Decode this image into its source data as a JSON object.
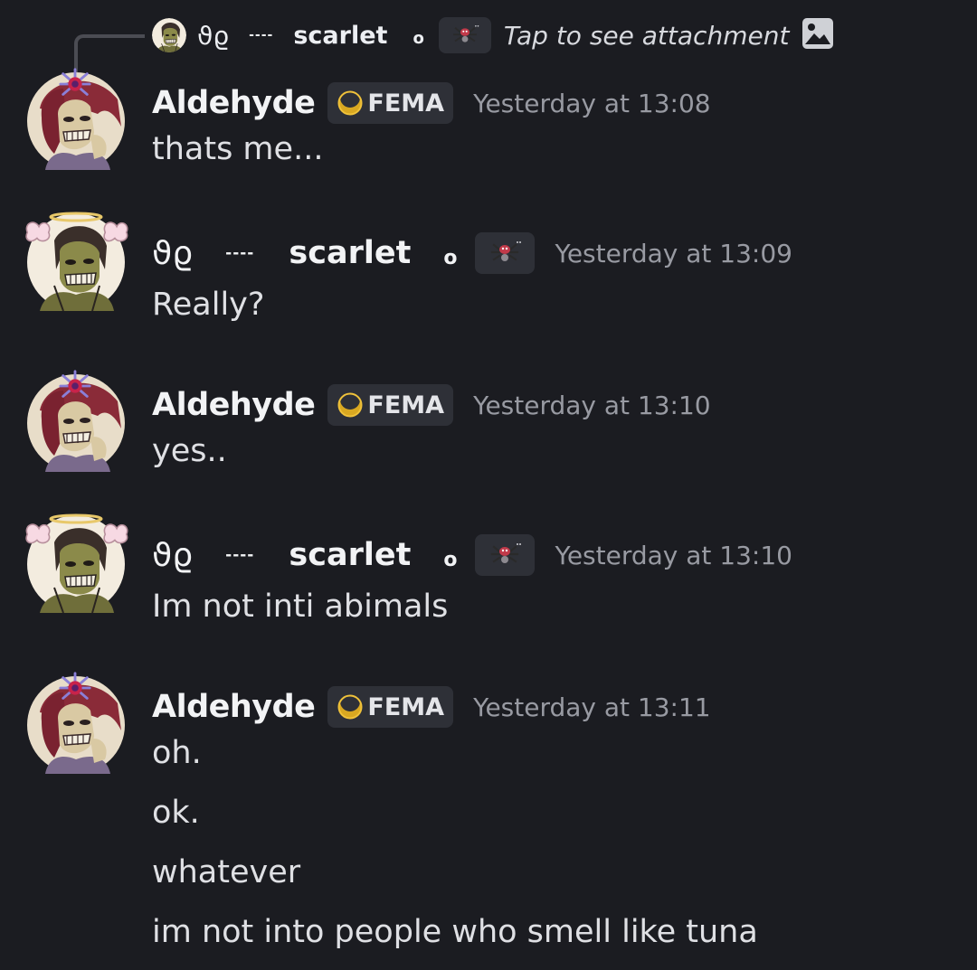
{
  "reply": {
    "author_glyphs": "ϑϱ",
    "author_dash": "----",
    "author_name": "scarlet",
    "author_ring": "o",
    "text": "Tap to see attachment"
  },
  "badge": {
    "tag_text": "FEMA"
  },
  "messages": [
    {
      "author": "Aldehyde",
      "timestamp": "Yesterday at 13:08",
      "lines": [
        "thats me..."
      ]
    },
    {
      "author_glyphs": "ϑϱ",
      "author_dash": "----",
      "author_name": "scarlet",
      "author_ring": "o",
      "timestamp": "Yesterday at 13:09",
      "lines": [
        "Really?"
      ]
    },
    {
      "author": "Aldehyde",
      "timestamp": "Yesterday at 13:10",
      "lines": [
        "yes.."
      ]
    },
    {
      "author_glyphs": "ϑϱ",
      "author_dash": "----",
      "author_name": "scarlet",
      "author_ring": "o",
      "timestamp": "Yesterday at 13:10",
      "lines": [
        "Im not inti abimals"
      ]
    },
    {
      "author": "Aldehyde",
      "timestamp": "Yesterday at 13:11",
      "lines": [
        "oh.",
        "ok.",
        "whatever",
        "im not into people who smell like tuna"
      ]
    }
  ],
  "icons": {
    "reply_avatar": "avatar-icon",
    "spider_badge": "spider-icon",
    "attachment": "image-icon",
    "tag_emblem": "moon-icon"
  },
  "colors": {
    "background": "#1b1c21",
    "tag_background": "#2e3037",
    "timestamp": "#989aa2",
    "author": "#f2f3f5",
    "text": "#dfe0e4"
  }
}
